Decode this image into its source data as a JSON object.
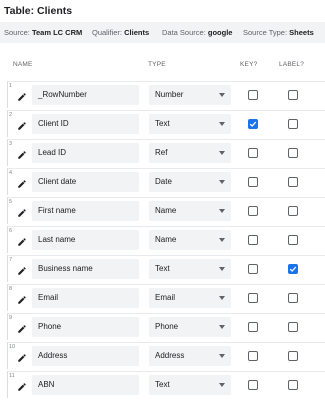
{
  "title": "Table: Clients",
  "meta": {
    "source_label": "Source:",
    "source_value": "Team LC CRM",
    "qualifier_label": "Qualifier:",
    "qualifier_value": "Clients",
    "datasource_label": "Data Source:",
    "datasource_value": "google",
    "sourcetype_label": "Source Type:",
    "sourcetype_value": "Sheets"
  },
  "headers": {
    "name": "NAME",
    "type": "TYPE",
    "key": "KEY?",
    "label": "LABEL?"
  },
  "columns": [
    {
      "num": "1",
      "name": "_RowNumber",
      "type": "Number",
      "key": false,
      "label": false
    },
    {
      "num": "2",
      "name": "Client ID",
      "type": "Text",
      "key": true,
      "label": false
    },
    {
      "num": "3",
      "name": "Lead ID",
      "type": "Ref",
      "key": false,
      "label": false
    },
    {
      "num": "4",
      "name": "Client date",
      "type": "Date",
      "key": false,
      "label": false
    },
    {
      "num": "5",
      "name": "First name",
      "type": "Name",
      "key": false,
      "label": false
    },
    {
      "num": "6",
      "name": "Last name",
      "type": "Name",
      "key": false,
      "label": false
    },
    {
      "num": "7",
      "name": "Business name",
      "type": "Text",
      "key": false,
      "label": true
    },
    {
      "num": "8",
      "name": "Email",
      "type": "Email",
      "key": false,
      "label": false
    },
    {
      "num": "9",
      "name": "Phone",
      "type": "Phone",
      "key": false,
      "label": false
    },
    {
      "num": "10",
      "name": "Address",
      "type": "Address",
      "key": false,
      "label": false
    },
    {
      "num": "11",
      "name": "ABN",
      "type": "Text",
      "key": false,
      "label": false
    }
  ],
  "colors": {
    "accent": "#1a73e8",
    "field_bg": "#f1f3f4"
  },
  "icons": {
    "edit": "pencil-icon",
    "dropdown": "caret-down-icon",
    "check": "check-icon"
  }
}
